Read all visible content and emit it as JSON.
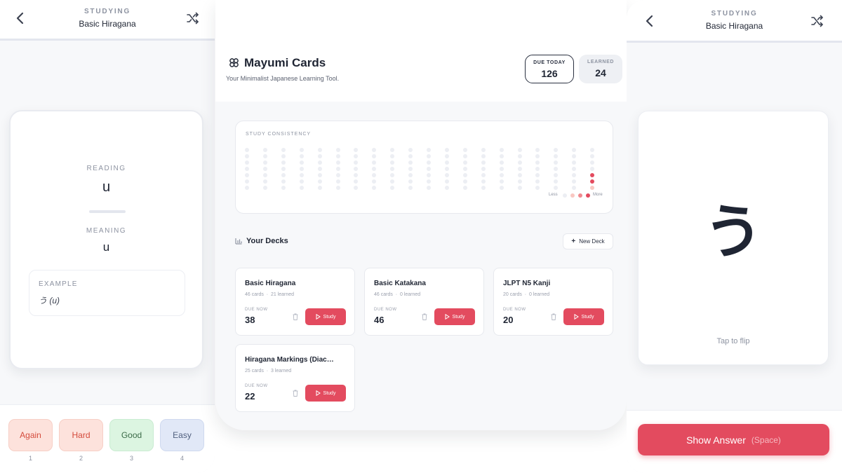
{
  "left_screen": {
    "header": {
      "kicker": "STUDYING",
      "deck_title": "Basic Hiragana"
    },
    "card": {
      "reading_label": "READING",
      "reading_value": "u",
      "meaning_label": "MEANING",
      "meaning_value": "u",
      "example_label": "EXAMPLE",
      "example_value": "う (u)"
    },
    "ratings": [
      {
        "label": "Again",
        "key": "1"
      },
      {
        "label": "Hard",
        "key": "2"
      },
      {
        "label": "Good",
        "key": "3"
      },
      {
        "label": "Easy",
        "key": "4"
      }
    ]
  },
  "dashboard": {
    "brand": "Mayumi Cards",
    "tagline": "Your Minimalist Japanese Learning Tool.",
    "stats": {
      "due_label": "DUE TODAY",
      "due_value": "126",
      "learned_label": "LEARNED",
      "learned_value": "24"
    },
    "consistency": {
      "title": "STUDY CONSISTENCY",
      "legend_less": "Less",
      "legend_more": "More",
      "week_columns": 20,
      "days_per_week": 7,
      "activity": [
        {
          "week": 20,
          "day": 4,
          "level": 3
        },
        {
          "week": 20,
          "day": 5,
          "level": 3
        },
        {
          "week": 20,
          "day": 6,
          "level": 1
        }
      ],
      "colors": {
        "empty": "#eceef3",
        "level1": "#f9c8c2",
        "level2": "#f08a8f",
        "level3": "#e34b5f"
      }
    },
    "decks_title": "Your Decks",
    "new_deck_label": "New Deck",
    "decks": [
      {
        "name": "Basic Hiragana",
        "cards": "46 cards",
        "learned": "21 learned",
        "due_label": "DUE NOW",
        "due": "38",
        "study_label": "Study"
      },
      {
        "name": "Basic Katakana",
        "cards": "46 cards",
        "learned": "0 learned",
        "due_label": "DUE NOW",
        "due": "46",
        "study_label": "Study"
      },
      {
        "name": "JLPT N5 Kanji",
        "cards": "20 cards",
        "learned": "0 learned",
        "due_label": "DUE NOW",
        "due": "20",
        "study_label": "Study"
      },
      {
        "name": "Hiragana Markings (Diac…",
        "cards": "25 cards",
        "learned": "3 learned",
        "due_label": "DUE NOW",
        "due": "22",
        "study_label": "Study"
      }
    ],
    "accent_color": "#e34b5f"
  },
  "right_screen": {
    "header": {
      "kicker": "STUDYING",
      "deck_title": "Basic Hiragana"
    },
    "card": {
      "kana": "う",
      "hint": "Tap to flip"
    },
    "show_answer": {
      "label": "Show Answer",
      "shortcut": "(Space)"
    }
  }
}
